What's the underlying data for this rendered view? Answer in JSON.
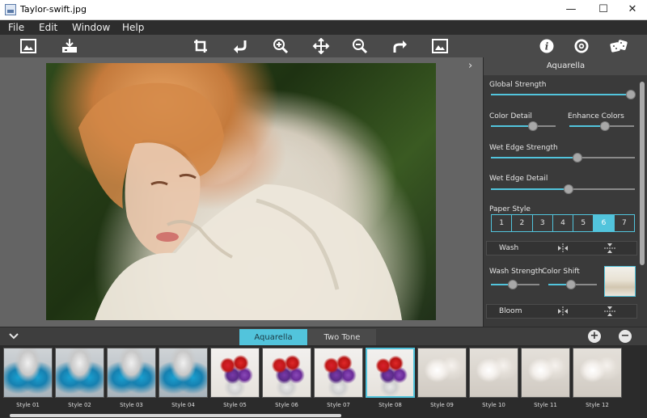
{
  "window": {
    "title": "Taylor-swift.jpg",
    "minimize": "—",
    "maximize": "☐",
    "close": "✕"
  },
  "menu": [
    "File",
    "Edit",
    "Window",
    "Help"
  ],
  "toolbar": {
    "icons": [
      "open-image-icon",
      "save-icon",
      "crop-icon",
      "undo-icon",
      "zoom-in-icon",
      "move-icon",
      "zoom-out-icon",
      "redo-icon",
      "compare-icon",
      "info-icon",
      "settings-icon",
      "random-icon"
    ]
  },
  "panel": {
    "title": "Aquarella",
    "global_strength": {
      "label": "Global Strength",
      "value": 0.97
    },
    "color_detail": {
      "label": "Color Detail",
      "value": 0.65
    },
    "enhance_colors": {
      "label": "Enhance Colors",
      "value": 0.55
    },
    "wet_edge_strength": {
      "label": "Wet Edge Strength",
      "value": 0.6
    },
    "wet_edge_detail": {
      "label": "Wet Edge Detail",
      "value": 0.54
    },
    "paper_style": {
      "label": "Paper Style",
      "options": [
        "1",
        "2",
        "3",
        "4",
        "5",
        "6",
        "7"
      ],
      "selected": "6"
    },
    "wash": {
      "label": "Wash"
    },
    "wash_strength": {
      "label": "Wash Strength",
      "value": 0.45
    },
    "color_shift": {
      "label": "Color Shift",
      "value": 0.47
    },
    "bloom": {
      "label": "Bloom"
    }
  },
  "tabs": {
    "active": "Aquarella",
    "inactive": "Two Tone"
  },
  "styles": [
    {
      "label": "Style 01",
      "kind": "face"
    },
    {
      "label": "Style 02",
      "kind": "face"
    },
    {
      "label": "Style 03",
      "kind": "face"
    },
    {
      "label": "Style 04",
      "kind": "face"
    },
    {
      "label": "Style 05",
      "kind": "flower"
    },
    {
      "label": "Style 06",
      "kind": "flower"
    },
    {
      "label": "Style 07",
      "kind": "flower"
    },
    {
      "label": "Style 08",
      "kind": "flower",
      "selected": true
    },
    {
      "label": "Style 09",
      "kind": "orchid"
    },
    {
      "label": "Style 10",
      "kind": "orchid"
    },
    {
      "label": "Style 11",
      "kind": "orchid"
    },
    {
      "label": "Style 12",
      "kind": "orchid"
    }
  ],
  "colors": {
    "accent": "#52c4dc",
    "background": "#3c3c3c"
  }
}
